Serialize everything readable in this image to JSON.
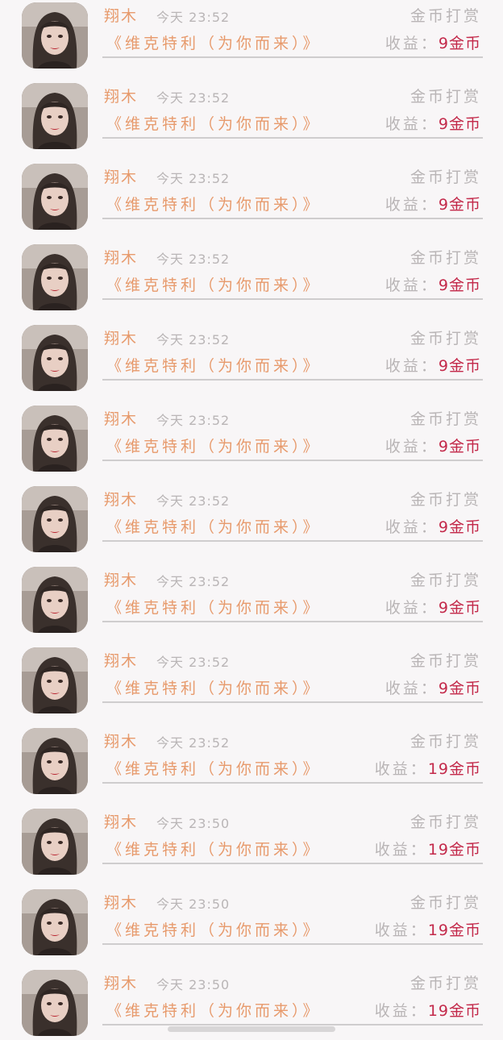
{
  "records": [
    {
      "name": "翔木",
      "time": "今天 23:52",
      "type": "金币打赏",
      "title": "《维克特利（为你而来）》",
      "earn_label": "收益：",
      "earn_value": "9金币"
    },
    {
      "name": "翔木",
      "time": "今天 23:52",
      "type": "金币打赏",
      "title": "《维克特利（为你而来）》",
      "earn_label": "收益：",
      "earn_value": "9金币"
    },
    {
      "name": "翔木",
      "time": "今天 23:52",
      "type": "金币打赏",
      "title": "《维克特利（为你而来）》",
      "earn_label": "收益：",
      "earn_value": "9金币"
    },
    {
      "name": "翔木",
      "time": "今天 23:52",
      "type": "金币打赏",
      "title": "《维克特利（为你而来）》",
      "earn_label": "收益：",
      "earn_value": "9金币"
    },
    {
      "name": "翔木",
      "time": "今天 23:52",
      "type": "金币打赏",
      "title": "《维克特利（为你而来）》",
      "earn_label": "收益：",
      "earn_value": "9金币"
    },
    {
      "name": "翔木",
      "time": "今天 23:52",
      "type": "金币打赏",
      "title": "《维克特利（为你而来）》",
      "earn_label": "收益：",
      "earn_value": "9金币"
    },
    {
      "name": "翔木",
      "time": "今天 23:52",
      "type": "金币打赏",
      "title": "《维克特利（为你而来）》",
      "earn_label": "收益：",
      "earn_value": "9金币"
    },
    {
      "name": "翔木",
      "time": "今天 23:52",
      "type": "金币打赏",
      "title": "《维克特利（为你而来）》",
      "earn_label": "收益：",
      "earn_value": "9金币"
    },
    {
      "name": "翔木",
      "time": "今天 23:52",
      "type": "金币打赏",
      "title": "《维克特利（为你而来）》",
      "earn_label": "收益：",
      "earn_value": "9金币"
    },
    {
      "name": "翔木",
      "time": "今天 23:52",
      "type": "金币打赏",
      "title": "《维克特利（为你而来）》",
      "earn_label": "收益：",
      "earn_value": "19金币"
    },
    {
      "name": "翔木",
      "time": "今天 23:50",
      "type": "金币打赏",
      "title": "《维克特利（为你而来）》",
      "earn_label": "收益：",
      "earn_value": "19金币"
    },
    {
      "name": "翔木",
      "time": "今天 23:50",
      "type": "金币打赏",
      "title": "《维克特利（为你而来）》",
      "earn_label": "收益：",
      "earn_value": "19金币"
    },
    {
      "name": "翔木",
      "time": "今天 23:50",
      "type": "金币打赏",
      "title": "《维克特利（为你而来）》",
      "earn_label": "收益：",
      "earn_value": "19金币"
    }
  ],
  "colors": {
    "accent": "#e79a6c",
    "muted": "#b9b5b6",
    "earn_value": "#c3294a",
    "background": "#f8f6f7"
  }
}
